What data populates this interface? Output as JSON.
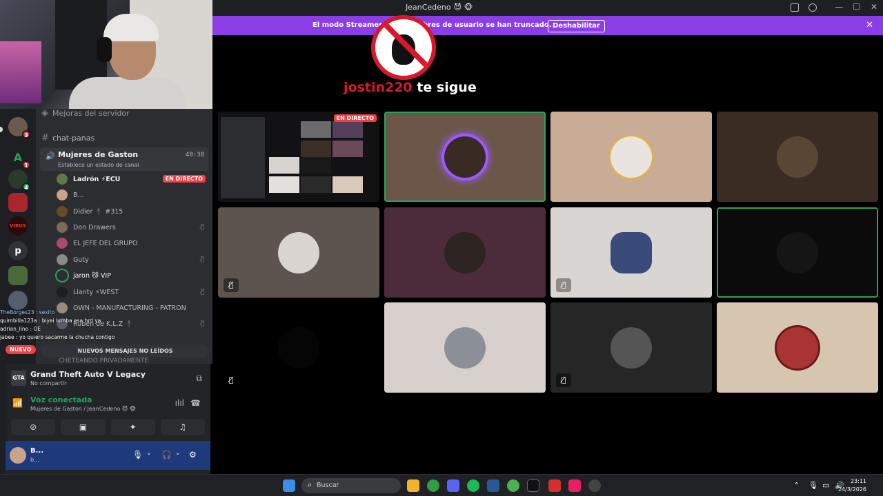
{
  "window": {
    "title": "JeanCedeno",
    "title_emoji": "😈 🐵"
  },
  "banner": {
    "message": "El modo Streamer est… nombres de usuario se han truncado.",
    "disable_label": "Deshabilitar",
    "close_icon": "close-icon"
  },
  "follow_alert": {
    "user": "jostin220",
    "text": "te sigue"
  },
  "servers": [
    {
      "badge": "3",
      "color": "#6b5a4e"
    },
    {
      "label": "A",
      "badge": "1",
      "color": "#1e1f22"
    },
    {
      "badge": "4",
      "color": "#2b3b2b"
    },
    {
      "color": "#a8262c"
    },
    {
      "label": "VIRUS",
      "color": "#2a0a0a"
    },
    {
      "label": "p",
      "color": "#313338"
    },
    {
      "color": "#4b6a3a"
    },
    {
      "color": "#555e6e"
    }
  ],
  "channels": {
    "top_cut": "Mejoras del servidor",
    "chat_channel": "chat-panas",
    "voice_channel": {
      "name": "Mujeres de Gaston",
      "timer": "48:38",
      "status": "Establece un estado de canal"
    },
    "members": [
      {
        "name": "Ladrón ⚡ECU",
        "live": "EN DIRECTO",
        "color": "#5b7a4c"
      },
      {
        "name": "B...",
        "color": "#c9a48a"
      },
      {
        "name": "Didier 🕴 #315",
        "color": "#6b4a2c"
      },
      {
        "name": "Don Drawers",
        "muted": true,
        "color": "#7a6a5a"
      },
      {
        "name": "EL JEFE DEL GRUPO",
        "color": "#a84a6a"
      },
      {
        "name": "Guty",
        "muted": true,
        "color": "#8a8a8a"
      },
      {
        "name": "jaron 😼 VIP",
        "color": "#2b2d31"
      },
      {
        "name": "Llanty ⚡WEST",
        "muted": true,
        "color": "#1e1f22"
      },
      {
        "name": "OWN - MANUFACTURING - PATRON",
        "color": "#9a8a7a"
      },
      {
        "name": "Ruben de K.L.Z 🕴",
        "muted": true,
        "color": "#5a5a6a"
      }
    ],
    "cut_member": "CHETEANDO PRIVADAMENTE"
  },
  "chat_overlay": [
    "TheBorges23 : sexito",
    "quimbilla123a : biyei lumba esa hrd ya",
    "adrian_lino : OE",
    "jabee : yo quiero sacarme la chucha contigo"
  ],
  "new_label": "NUEVO",
  "unread_label": "NUEVOS MENSAJES NO LEÍDOS",
  "activity": {
    "game": "Grand Theft Auto V Legacy",
    "sub": "No compartir",
    "game_icon_text": "GTA"
  },
  "voice": {
    "status": "Voz conectada",
    "channel": "Mujeres de Gaston / JeanCedeno 😈 🐵"
  },
  "user": {
    "name": "B...",
    "status": "b..."
  },
  "grid": {
    "live_label": "EN DIRECTO"
  },
  "taskbar": {
    "search_placeholder": "Buscar",
    "time": "23:11",
    "date": "24/3/2026"
  }
}
